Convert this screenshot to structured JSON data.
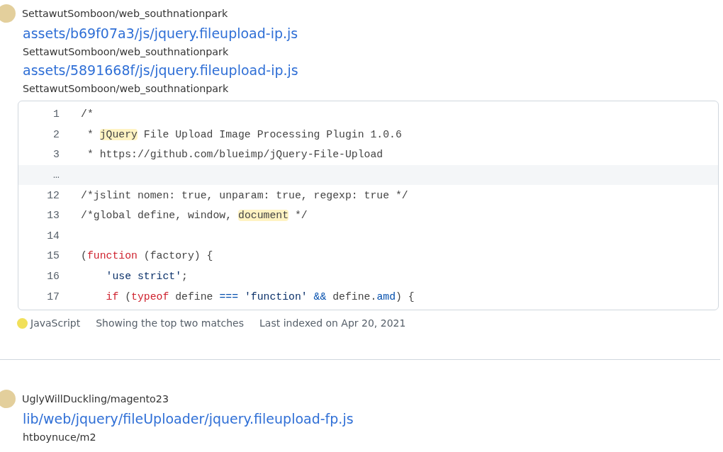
{
  "results": [
    {
      "repo": "SettawutSomboon/web_southnationpark",
      "files": [
        {
          "path": "assets/b69f07a3/js/jquery.fileupload-ip.js",
          "repo": "SettawutSomboon/web_southnationpark"
        },
        {
          "path": "assets/5891668f/js/jquery.fileupload-ip.js",
          "repo": "SettawutSomboon/web_southnationpark"
        }
      ],
      "code": [
        {
          "kind": "code",
          "number": "1",
          "tokens": [
            {
              "text": "/*",
              "kind": "plain"
            }
          ]
        },
        {
          "kind": "code",
          "number": "2",
          "tokens": [
            {
              "text": " * ",
              "kind": "plain"
            },
            {
              "text": "jQuery",
              "kind": "match"
            },
            {
              "text": " File Upload Image Processing Plugin 1.0.6",
              "kind": "plain"
            }
          ]
        },
        {
          "kind": "code",
          "number": "3",
          "tokens": [
            {
              "text": " * https://github.com/blueimp/jQuery-File-Upload",
              "kind": "plain"
            }
          ]
        },
        {
          "kind": "gap",
          "number": "…"
        },
        {
          "kind": "code",
          "number": "12",
          "tokens": [
            {
              "text": "/*jslint nomen: true, unparam: true, regexp: true */",
              "kind": "plain"
            }
          ]
        },
        {
          "kind": "code",
          "number": "13",
          "tokens": [
            {
              "text": "/*global define, window, ",
              "kind": "plain"
            },
            {
              "text": "document",
              "kind": "match"
            },
            {
              "text": " */",
              "kind": "plain"
            }
          ]
        },
        {
          "kind": "code",
          "number": "14"
        },
        {
          "kind": "code",
          "number": "15",
          "tokens": [
            {
              "text": "(",
              "kind": "plain"
            },
            {
              "text": "function",
              "kind": "keyword"
            },
            {
              "text": " (factory) {",
              "kind": "plain"
            }
          ]
        },
        {
          "kind": "code",
          "number": "16",
          "tokens": [
            {
              "text": "    'use strict'",
              "kind": "string"
            },
            {
              "text": ";",
              "kind": "plain"
            }
          ]
        },
        {
          "kind": "code",
          "number": "17",
          "tokens": [
            {
              "text": "    if",
              "kind": "keyword"
            },
            {
              "text": " (",
              "kind": "plain"
            },
            {
              "text": "typeof",
              "kind": "keyword"
            },
            {
              "text": " define ",
              "kind": "plain"
            },
            {
              "text": "===",
              "kind": "operator"
            },
            {
              "text": " 'function'",
              "kind": "string"
            },
            {
              "text": " &&",
              "kind": "operator"
            },
            {
              "text": " define.",
              "kind": "plain"
            },
            {
              "text": "amd",
              "kind": "operator"
            },
            {
              "text": ") {",
              "kind": "plain"
            }
          ]
        }
      ],
      "footer": {
        "language": "JavaScript",
        "matches": "Showing the top two matches",
        "indexed": "Last indexed on Apr 20, 2021"
      }
    },
    {
      "repo": "UglyWillDuckling/magento23",
      "files": [
        {
          "path": "lib/web/jquery/fileUploader/jquery.fileupload-fp.js",
          "repo": "htboynuce/m2"
        }
      ]
    }
  ]
}
